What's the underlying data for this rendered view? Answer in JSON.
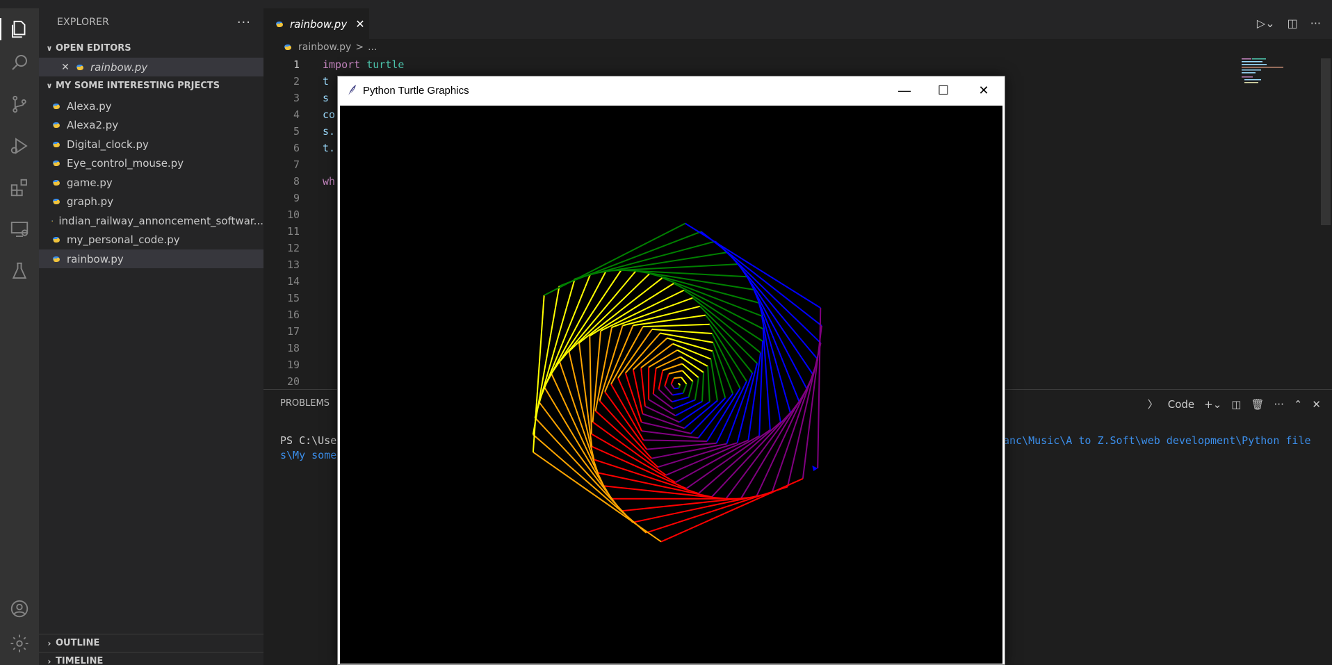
{
  "sidebar": {
    "title": "EXPLORER",
    "more": "···",
    "open_editors_label": "OPEN EDITORS",
    "open_file": "rainbow.py",
    "folder_label": "MY SOME INTERESTING PRJECTS",
    "files": [
      "Alexa.py",
      "Alexa2.py",
      "Digital_clock.py",
      "Eye_control_mouse.py",
      "game.py",
      "graph.py",
      "indian_railway_annoncement_softwar...",
      "my_personal_code.py",
      "rainbow.py"
    ],
    "selected_file": "rainbow.py",
    "outline_label": "OUTLINE",
    "timeline_label": "TIMELINE"
  },
  "activity_icons": [
    "files-icon",
    "search-icon",
    "source-control-icon",
    "run-debug-icon",
    "extensions-icon",
    "remote-explorer-icon",
    "testing-icon",
    "account-icon",
    "settings-gear-icon"
  ],
  "editor": {
    "tab_label": "rainbow.py",
    "breadcrumb_file": "rainbow.py",
    "breadcrumb_sep": ">",
    "breadcrumb_more": "...",
    "line_numbers": [
      "1",
      "2",
      "3",
      "4",
      "5",
      "6",
      "7",
      "8",
      "9",
      "10",
      "11",
      "12",
      "13",
      "14",
      "15",
      "16",
      "17",
      "18",
      "19",
      "20"
    ],
    "lines": {
      "l1_kw": "import",
      "l1_mod": " turtle",
      "l2": "t",
      "l3": "s",
      "l4": "co",
      "l5": "s.",
      "l6": "t.",
      "l8": "wh"
    }
  },
  "panel": {
    "tab": "PROBLEMS",
    "terminal_kind": "Code",
    "term_line1_a": "PS C:\\Use",
    "term_line1_b": "anc\\Music\\A to Z.Soft\\web development\\Python file",
    "term_line2": "s\\My some"
  },
  "turtle_window": {
    "title": "Python Turtle Graphics",
    "colors": [
      "#ff0000",
      "#ffa500",
      "#ffff00",
      "#008000",
      "#0000ff",
      "#800080"
    ]
  }
}
